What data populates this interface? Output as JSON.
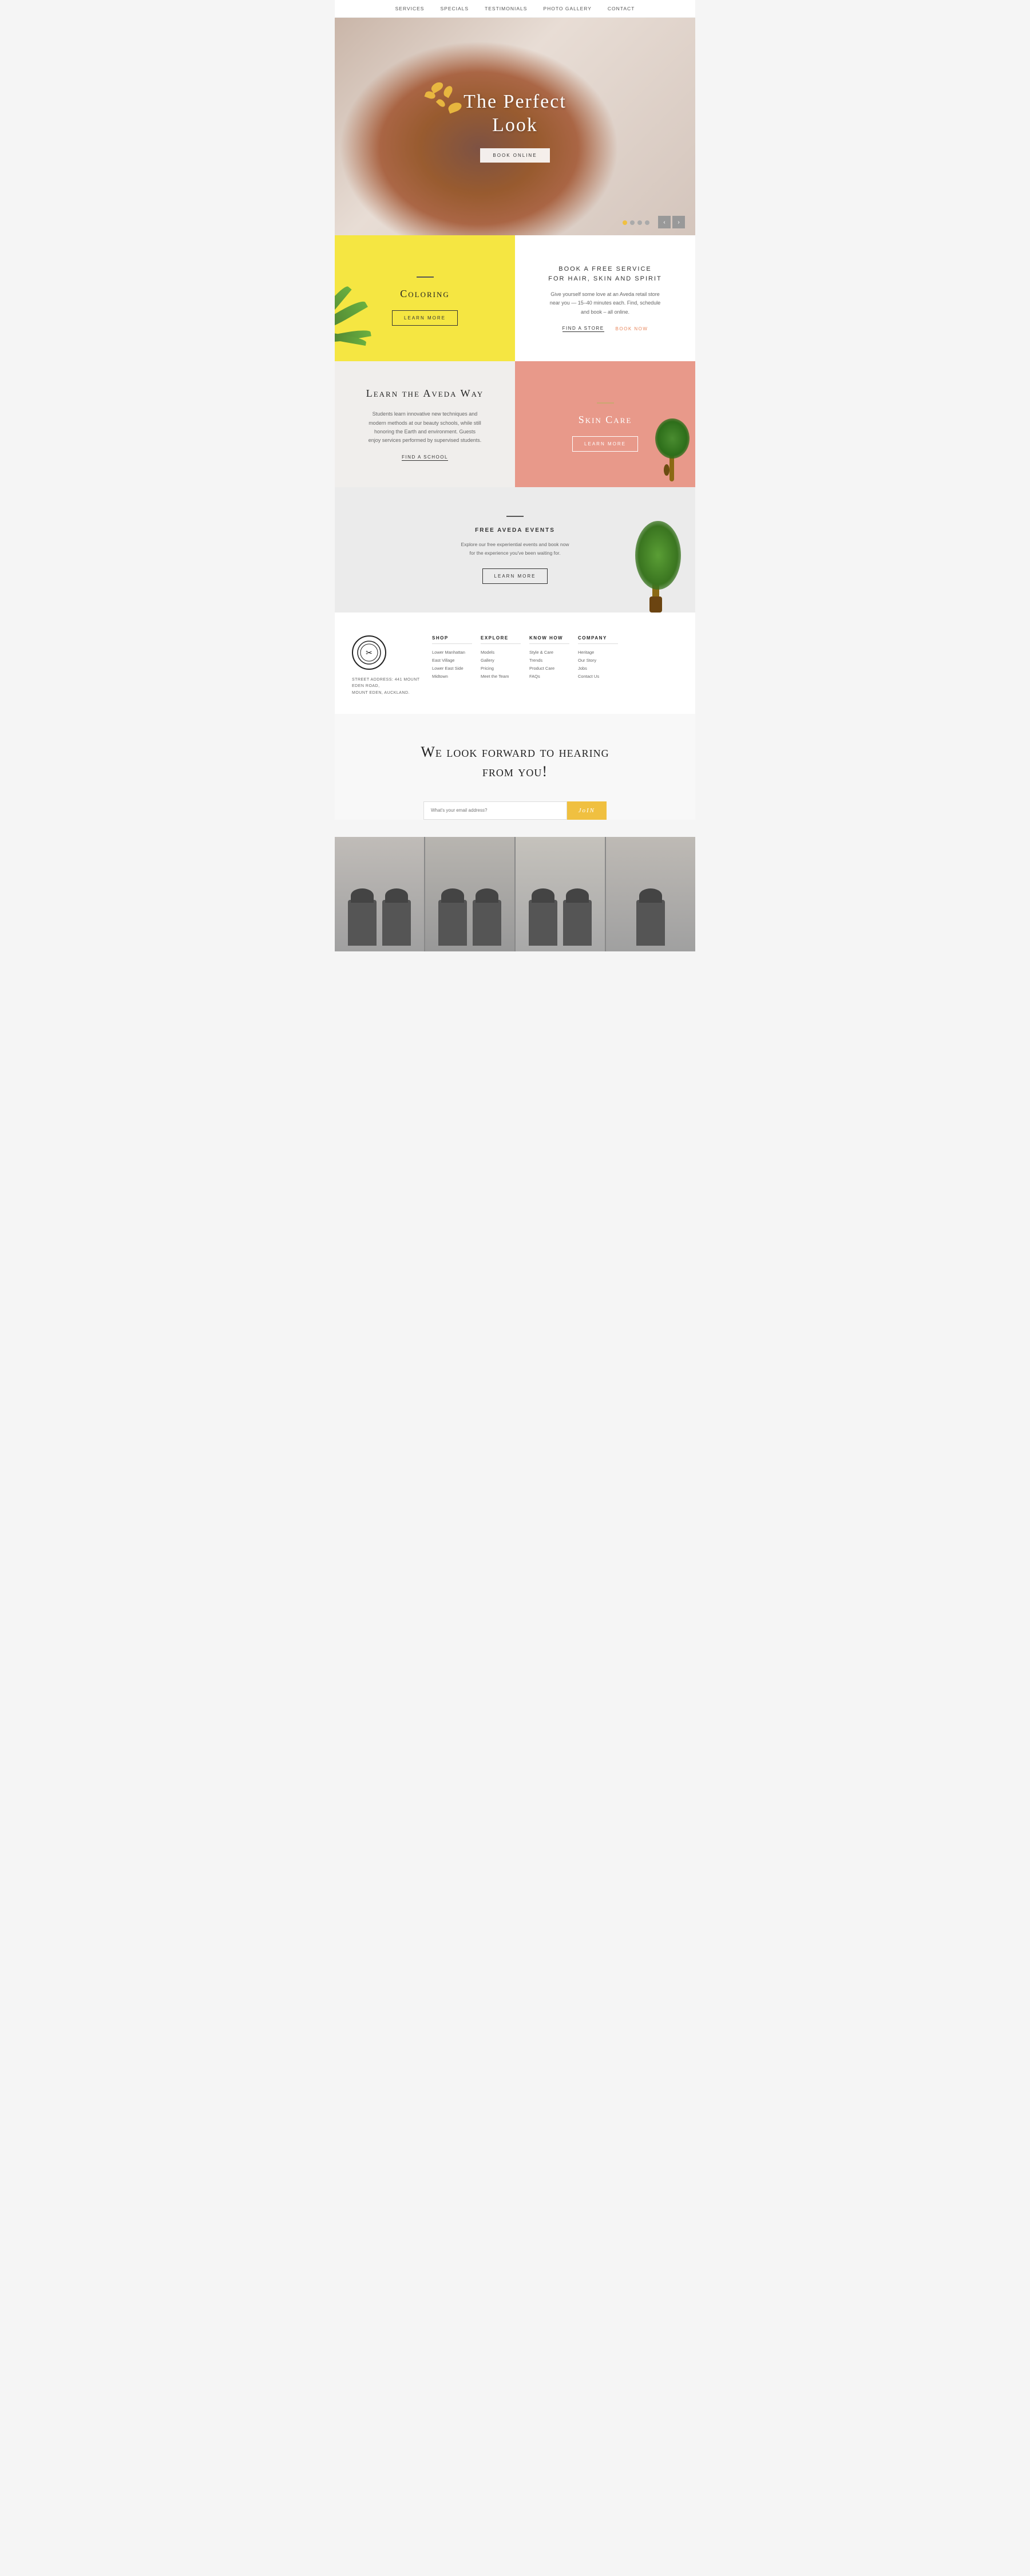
{
  "nav": {
    "links": [
      "Services",
      "Specials",
      "Testimonials",
      "Photo Gallery",
      "Contact"
    ]
  },
  "hero": {
    "title": "The Perfect\nLook",
    "cta": "Book Online",
    "dots": [
      1,
      2,
      3,
      4
    ],
    "active_dot": 0
  },
  "coloring": {
    "title": "Coloring",
    "btn": "Learn More"
  },
  "free_service": {
    "title": "Book a Free Service\nFor Hair, Skin and Spirit",
    "text": "Give yourself some love at an Aveda retail store near you — 15–40 minutes each. Find, schedule and book – all online.",
    "find_store": "Find a Store",
    "book_now": "Book Now"
  },
  "aveda_way": {
    "title": "Learn the Aveda Way",
    "text": "Students learn innovative new techniques and modern methods at our beauty schools, while still honoring the Earth and environment. Guests enjoy services performed by supervised students.",
    "link": "Find a School"
  },
  "skin_care": {
    "title": "Skin Care",
    "btn": "Learn More"
  },
  "events": {
    "divider": true,
    "title": "Free Aveda Events",
    "text": "Explore our free experiential events and book now\nfor the experience you've been waiting for.",
    "btn": "Learn More"
  },
  "footer": {
    "logo_symbol": "✂",
    "address_line1": "Street address: 441 Mount Eden Road,",
    "address_line2": "Mount Eden, Auckland.",
    "shop": {
      "heading": "Shop",
      "links": [
        "Lower Manhattan",
        "East Village",
        "Lower East Side",
        "Midtown"
      ]
    },
    "explore": {
      "heading": "Explore",
      "links": [
        "Models",
        "Gallery",
        "Pricing",
        "Meet the Team"
      ]
    },
    "know_how": {
      "heading": "Know How",
      "links": [
        "Style & Care",
        "Trends",
        "Product Care",
        "FAQs"
      ]
    },
    "company": {
      "heading": "Company",
      "links": [
        "Heritage",
        "Our Story",
        "Jobs",
        "Contact Us"
      ]
    }
  },
  "contact": {
    "title": "We look forward to hearing\nfrom you!",
    "email_placeholder": "What's your email address?",
    "join_btn": "JoIN"
  }
}
